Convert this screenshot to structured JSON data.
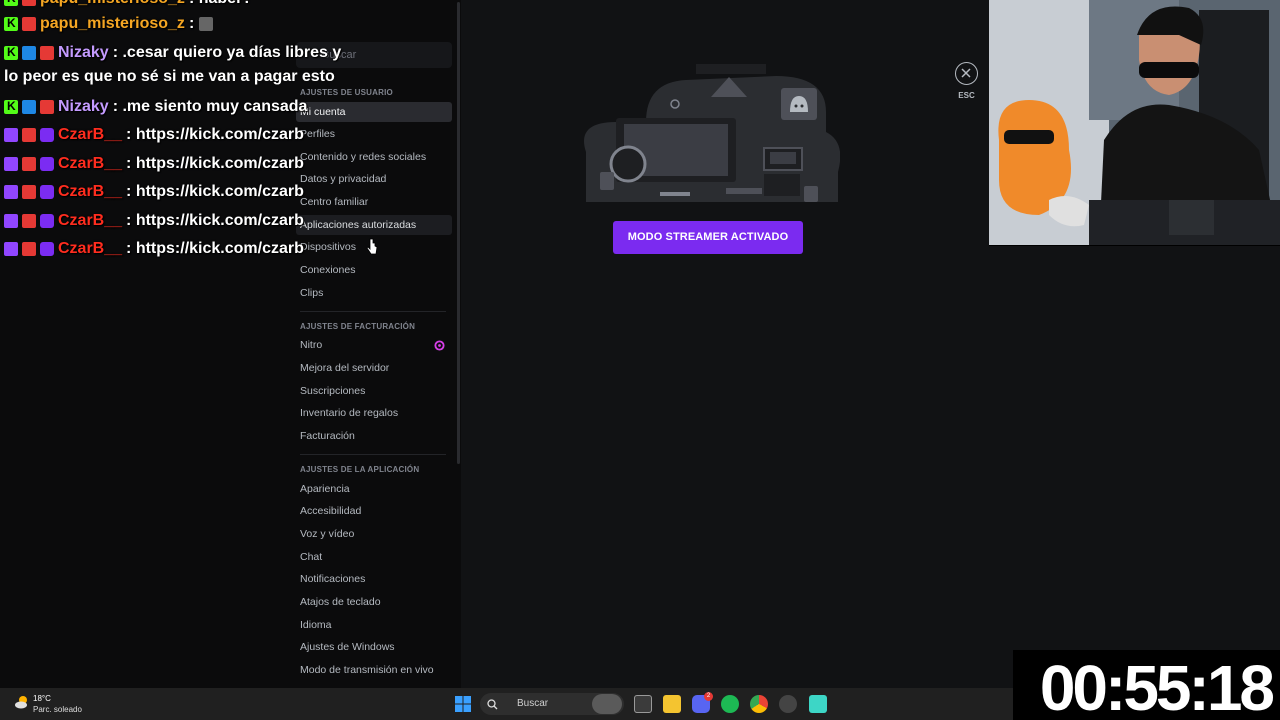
{
  "settings": {
    "search_placeholder": "Buscar",
    "sections": [
      {
        "title": "AJUSTES DE USUARIO",
        "items": [
          "Mi cuenta",
          "Perfiles",
          "Contenido y redes sociales",
          "Datos y privacidad",
          "Centro familiar",
          "Aplicaciones autorizadas",
          "Dispositivos",
          "Conexiones",
          "Clips"
        ]
      },
      {
        "title": "AJUSTES DE FACTURACIÓN",
        "items": [
          "Nitro",
          "Mejora del servidor",
          "Suscripciones",
          "Inventario de regalos",
          "Facturación"
        ]
      },
      {
        "title": "AJUSTES DE LA APLICACIÓN",
        "items": [
          "Apariencia",
          "Accesibilidad",
          "Voz y vídeo",
          "Chat",
          "Notificaciones",
          "Atajos de teclado",
          "Idioma",
          "Ajustes de Windows",
          "Modo de transmisión en vivo"
        ]
      }
    ],
    "selected_item": "Mi cuenta",
    "hover_item": "Aplicaciones autorizadas"
  },
  "streamer": {
    "button_label": "MODO STREAMER ACTIVADO",
    "close_label": "ESC"
  },
  "chat": [
    {
      "user": "papu_misterioso_z",
      "text": "haber?"
    },
    {
      "user": "papu_misterioso_z",
      "text": ""
    },
    {
      "user": "Nizaky",
      "text": ".cesar quiero ya días libres y"
    },
    {
      "user": "",
      "text": "lo peor es que no sé si me van a pagar esto"
    },
    {
      "user": "Nizaky",
      "text": ".me siento muy cansada"
    },
    {
      "user": "CzarB__",
      "text": "https://kick.com/czarb"
    },
    {
      "user": "CzarB__",
      "text": "https://kick.com/czarb"
    },
    {
      "user": "CzarB__",
      "text": "https://kick.com/czarb"
    },
    {
      "user": "CzarB__",
      "text": "https://kick.com/czarb"
    },
    {
      "user": "CzarB__",
      "text": "https://kick.com/czarb"
    }
  ],
  "taskbar": {
    "weather_temp": "18°C",
    "weather_desc": "Parc. soleado",
    "search_label": "Buscar",
    "discord_badge": "2"
  },
  "timer": "00:55:18",
  "colors": {
    "streamer_button": "#7b2bf0",
    "sidebar_bg": "#0b0b0c",
    "main_bg": "#111214"
  }
}
